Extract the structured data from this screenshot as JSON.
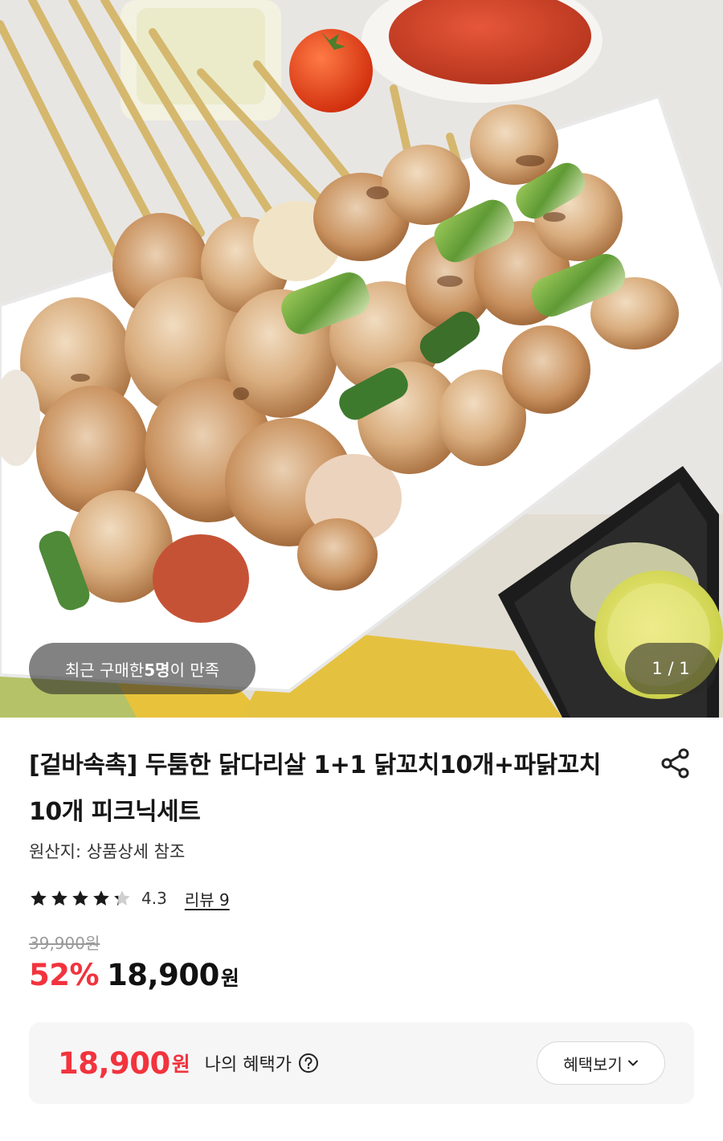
{
  "gallery": {
    "social_proof_prefix": "최근 구매한 ",
    "social_proof_count": "5명",
    "social_proof_suffix": "이 만족",
    "counter": "1 / 1"
  },
  "product": {
    "title": "[겉바속촉] 두툼한 닭다리살 1+1 닭꼬치10개+파닭꼬치10개 피크닉세트",
    "origin": "원산지: 상품상세 참조",
    "rating": 4.3,
    "rating_text": "4.3",
    "review_link": "리뷰 9",
    "original_price": "39,900원",
    "discount": "52%",
    "sale_price": "18,900",
    "currency": "원"
  },
  "benefit": {
    "price": "18,900",
    "currency": "원",
    "label": "나의 혜택가",
    "button_label": "혜택보기"
  },
  "icons": {
    "share": "share-icon",
    "help": "question-circle-icon",
    "chevron": "chevron-down-icon",
    "star": "star-icon"
  },
  "colors": {
    "accent_red": "#f2333d",
    "star": "#1a1a1a",
    "star_empty": "#cfcfcf"
  }
}
